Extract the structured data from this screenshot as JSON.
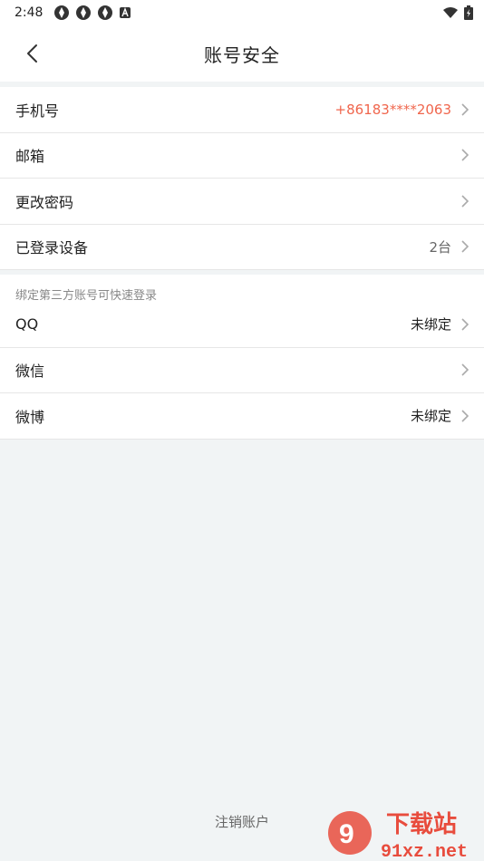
{
  "status_bar": {
    "time": "2:48",
    "notif_icons": [
      "app-icon",
      "app-icon",
      "app-icon",
      "a-icon"
    ],
    "right_icons": [
      "wifi-icon",
      "battery-icon"
    ]
  },
  "header": {
    "title": "账号安全",
    "back_icon": "chevron-left-icon"
  },
  "section1": {
    "items": [
      {
        "label": "手机号",
        "value": "+86183****2063",
        "accent": true
      },
      {
        "label": "邮箱",
        "value": ""
      },
      {
        "label": "更改密码",
        "value": ""
      },
      {
        "label": "已登录设备",
        "value": "2台"
      }
    ]
  },
  "section2": {
    "hint": "绑定第三方账号可快速登录",
    "items": [
      {
        "label": "QQ",
        "value": "未绑定"
      },
      {
        "label": "微信",
        "value": ""
      },
      {
        "label": "微博",
        "value": "未绑定"
      }
    ]
  },
  "footer": {
    "cancel_account": "注销账户"
  },
  "watermark": {
    "brand": "下载站",
    "domain": "91xz.net"
  },
  "colors": {
    "accent": "#f0664d",
    "background": "#f1f4f5",
    "watermark_red": "#e84c3d"
  }
}
